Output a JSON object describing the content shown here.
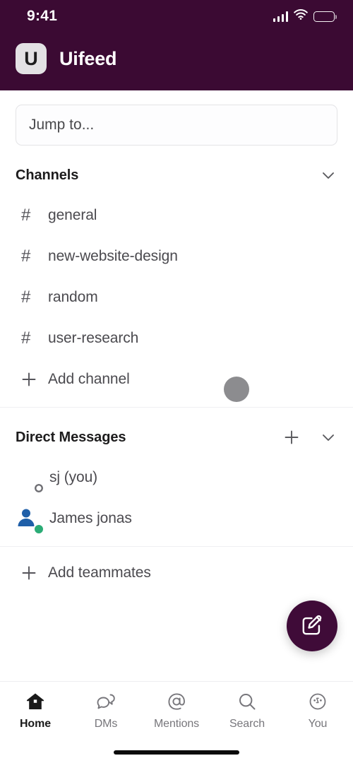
{
  "meta": {
    "colors": {
      "header_purple": "#3B0A33",
      "fab_purple": "#3F0B38",
      "online_green": "#2BAC76",
      "text_primary": "#1D1C1D",
      "text_secondary": "#4B4A4F",
      "divider": "#EFEFF2",
      "cursor_gray": "#8C8C8F"
    }
  },
  "status_bar": {
    "time": "9:41",
    "icons": [
      "cellular-signal-icon",
      "wifi-icon",
      "battery-icon"
    ]
  },
  "header": {
    "logo_letter": "U",
    "logo_name": "workspace-logo",
    "workspace_name": "Uifeed"
  },
  "search": {
    "placeholder": "Jump to...",
    "value": ""
  },
  "channels_section": {
    "title": "Channels",
    "collapse_icon": "chevron-down-icon",
    "items": [
      {
        "glyph": "#",
        "label": "general"
      },
      {
        "glyph": "#",
        "label": "new-website-design"
      },
      {
        "glyph": "#",
        "label": "random"
      },
      {
        "glyph": "#",
        "label": "user-research"
      }
    ],
    "add_action": {
      "glyph": "+",
      "label": "Add channel"
    }
  },
  "dm_section": {
    "title": "Direct Messages",
    "add_icon": "plus-icon",
    "collapse_icon": "chevron-down-icon",
    "items": [
      {
        "label": "sj (you)",
        "avatar": "photo-avatar",
        "presence": "away"
      },
      {
        "label": "James jonas",
        "avatar": "person-icon",
        "presence": "online"
      }
    ],
    "add_action": {
      "glyph": "+",
      "label": "Add teammates"
    }
  },
  "fab": {
    "name": "compose-button",
    "icon": "compose-icon"
  },
  "tabbar": {
    "tabs": [
      {
        "label": "Home",
        "icon": "home-icon",
        "active": true
      },
      {
        "label": "DMs",
        "icon": "chat-bubbles-icon",
        "active": false
      },
      {
        "label": "Mentions",
        "icon": "at-sign-icon",
        "active": false
      },
      {
        "label": "Search",
        "icon": "magnifier-icon",
        "active": false
      },
      {
        "label": "You",
        "icon": "face-circle-icon",
        "active": false
      }
    ]
  }
}
